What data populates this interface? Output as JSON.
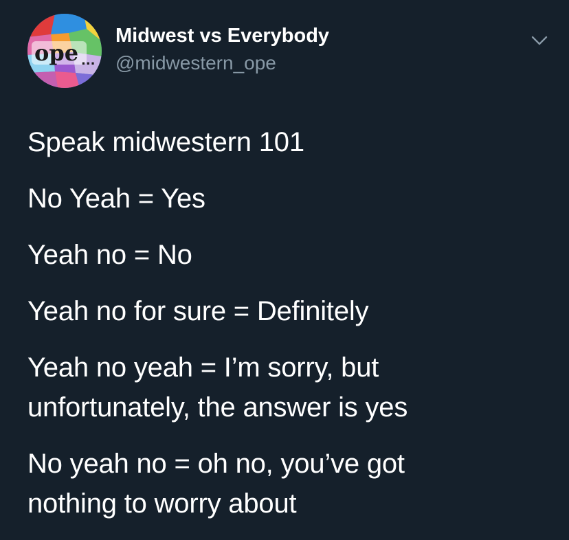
{
  "account": {
    "display_name": "Midwest vs Everybody",
    "handle": "@midwestern_ope",
    "avatar_text": "ope",
    "avatar_dots": "..."
  },
  "tweet": {
    "lines": [
      "Speak midwestern 101",
      "No Yeah = Yes",
      "Yeah no = No",
      "Yeah no for sure = Definitely",
      "Yeah no yeah = I’m sorry, but unfortunately, the answer is yes",
      "No yeah no = oh no, you’ve got nothing to worry about"
    ]
  },
  "icons": {
    "menu": "chevron-down-icon"
  },
  "colors": {
    "background": "#15202b",
    "text": "#ffffff",
    "secondary_text": "#8899a6"
  }
}
